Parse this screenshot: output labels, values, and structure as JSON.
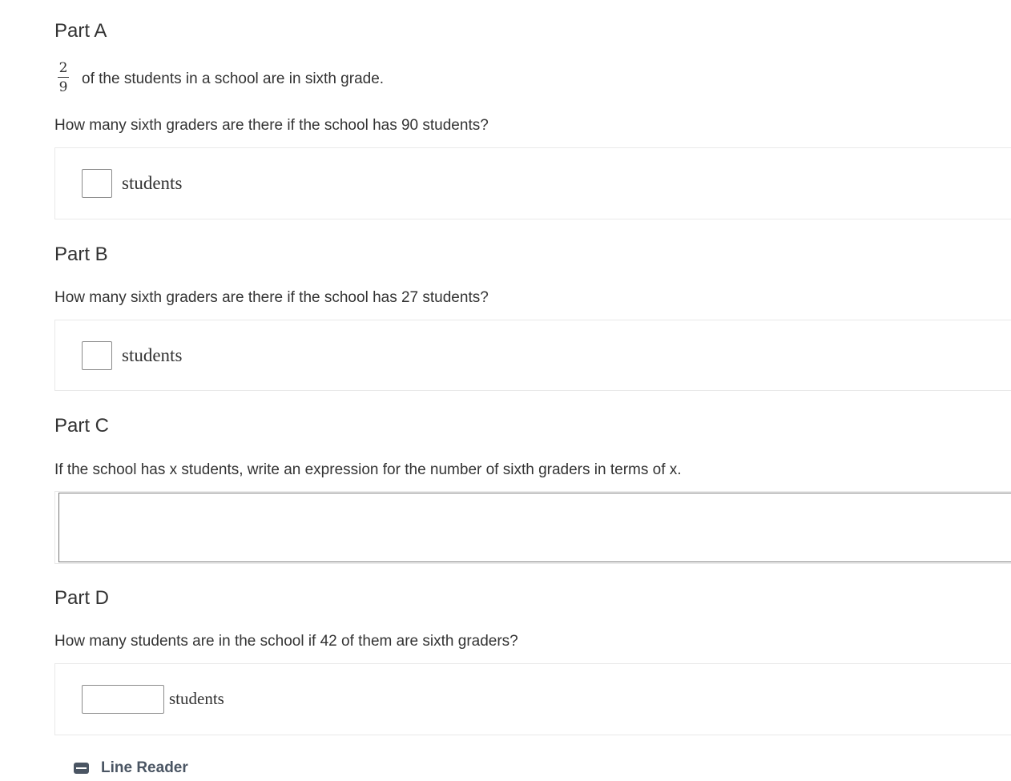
{
  "partA": {
    "heading": "Part A",
    "fraction": {
      "numerator": "2",
      "denominator": "9"
    },
    "statement": "of the students in a school are in sixth grade.",
    "question": "How many sixth graders are there if the school has 90 students?",
    "input_value": "",
    "unit": "students"
  },
  "partB": {
    "heading": "Part B",
    "question": "How many sixth graders are there if the school has 27 students?",
    "input_value": "",
    "unit": "students"
  },
  "partC": {
    "heading": "Part C",
    "question": "If the school has x students, write an expression for the number of sixth graders in terms of x.",
    "input_value": ""
  },
  "partD": {
    "heading": "Part D",
    "question": "How many students are in the school if 42 of them are sixth graders?",
    "input_value": "",
    "unit": "students"
  },
  "line_reader": {
    "label": "Line Reader",
    "icon": "minus-square-icon"
  },
  "colors": {
    "text": "#333333",
    "box_border": "#e9e9e9",
    "input_border": "#8a8a8a",
    "line_reader": "#4a5563"
  }
}
